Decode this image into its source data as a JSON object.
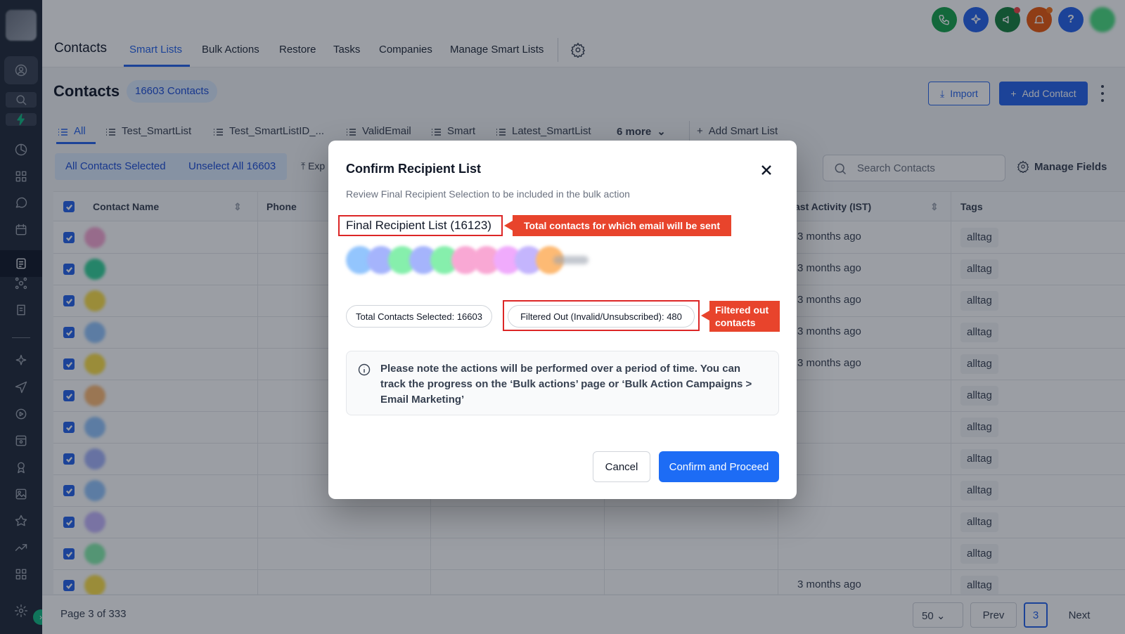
{
  "app": {
    "title": "Contacts",
    "nav_tabs": [
      "Smart Lists",
      "Bulk Actions",
      "Restore",
      "Tasks",
      "Companies",
      "Manage Smart Lists"
    ],
    "active_tab": "Smart Lists",
    "accent_color": "#2563eb",
    "help_label": "?"
  },
  "page": {
    "title": "Contacts",
    "count_badge": "16603 Contacts",
    "import_label": "Import",
    "add_contact_label": "Add Contact"
  },
  "smart_lists": {
    "tabs": [
      "All",
      "Test_SmartList",
      "Test_SmartListID_...",
      "ValidEmail",
      "Smart",
      "Latest_SmartList"
    ],
    "more_label": "6 more",
    "add_label": "Add Smart List"
  },
  "selection": {
    "all_selected": "All Contacts Selected",
    "unselect": "Unselect All 16603",
    "export": "Exp",
    "search_placeholder": "Search Contacts",
    "manage_fields": "Manage Fields"
  },
  "table": {
    "columns": [
      "Contact Name",
      "Phone",
      "ast Activity (IST)",
      "Tags"
    ],
    "rows": [
      {
        "last_activity": "3 months ago",
        "tag": "alltag"
      },
      {
        "last_activity": "3 months ago",
        "tag": "alltag"
      },
      {
        "last_activity": "3 months ago",
        "tag": "alltag"
      },
      {
        "last_activity": "3 months ago",
        "tag": "alltag"
      },
      {
        "last_activity": "3 months ago",
        "tag": "alltag"
      },
      {
        "last_activity": "",
        "tag": "alltag"
      },
      {
        "last_activity": "",
        "tag": "alltag"
      },
      {
        "last_activity": "",
        "tag": "alltag"
      },
      {
        "last_activity": "",
        "tag": "alltag"
      },
      {
        "last_activity": "",
        "tag": "alltag"
      },
      {
        "last_activity": "",
        "tag": "alltag"
      },
      {
        "last_activity": "3 months ago",
        "tag": "alltag"
      }
    ]
  },
  "pagination": {
    "page_info": "Page 3 of 333",
    "page_size": "50",
    "prev": "Prev",
    "current": "3",
    "next": "Next"
  },
  "modal": {
    "title": "Confirm Recipient List",
    "subtitle": "Review Final Recipient Selection to be included in the bulk action",
    "final_list": "Final Recipient List (16123)",
    "callout_total": "Total contacts for which email will be sent",
    "total_selected": "Total Contacts Selected: 16603",
    "filtered_out": "Filtered Out (Invalid/Unsubscribed): 480",
    "callout_filtered": "Filtered out contacts",
    "info": "Please note the actions will be performed over a period of time. You can track the progress on the ‘Bulk actions’ page or ‘Bulk Action Campaigns > Email Marketing’",
    "cancel_label": "Cancel",
    "confirm_label": "Confirm and Proceed",
    "callout_color": "#e8442c"
  }
}
